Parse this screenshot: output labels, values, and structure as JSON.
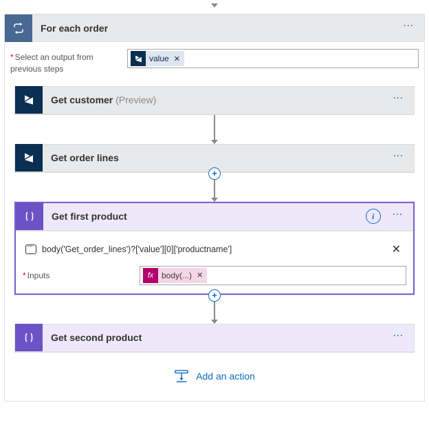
{
  "loop": {
    "title": "For each order",
    "select_label": "Select an output from previous steps",
    "token_label": "value"
  },
  "steps": {
    "get_customer": {
      "title": "Get customer",
      "preview": " (Preview)"
    },
    "get_order_lines": {
      "title": "Get order lines"
    },
    "get_first_product": {
      "title": "Get first product",
      "expression": "body('Get_order_lines')?['value'][0]['productname']",
      "inputs_label": "Inputs",
      "token_label": "body(...)"
    },
    "get_second_product": {
      "title": "Get second product"
    }
  },
  "buttons": {
    "add_action": "Add an action"
  }
}
